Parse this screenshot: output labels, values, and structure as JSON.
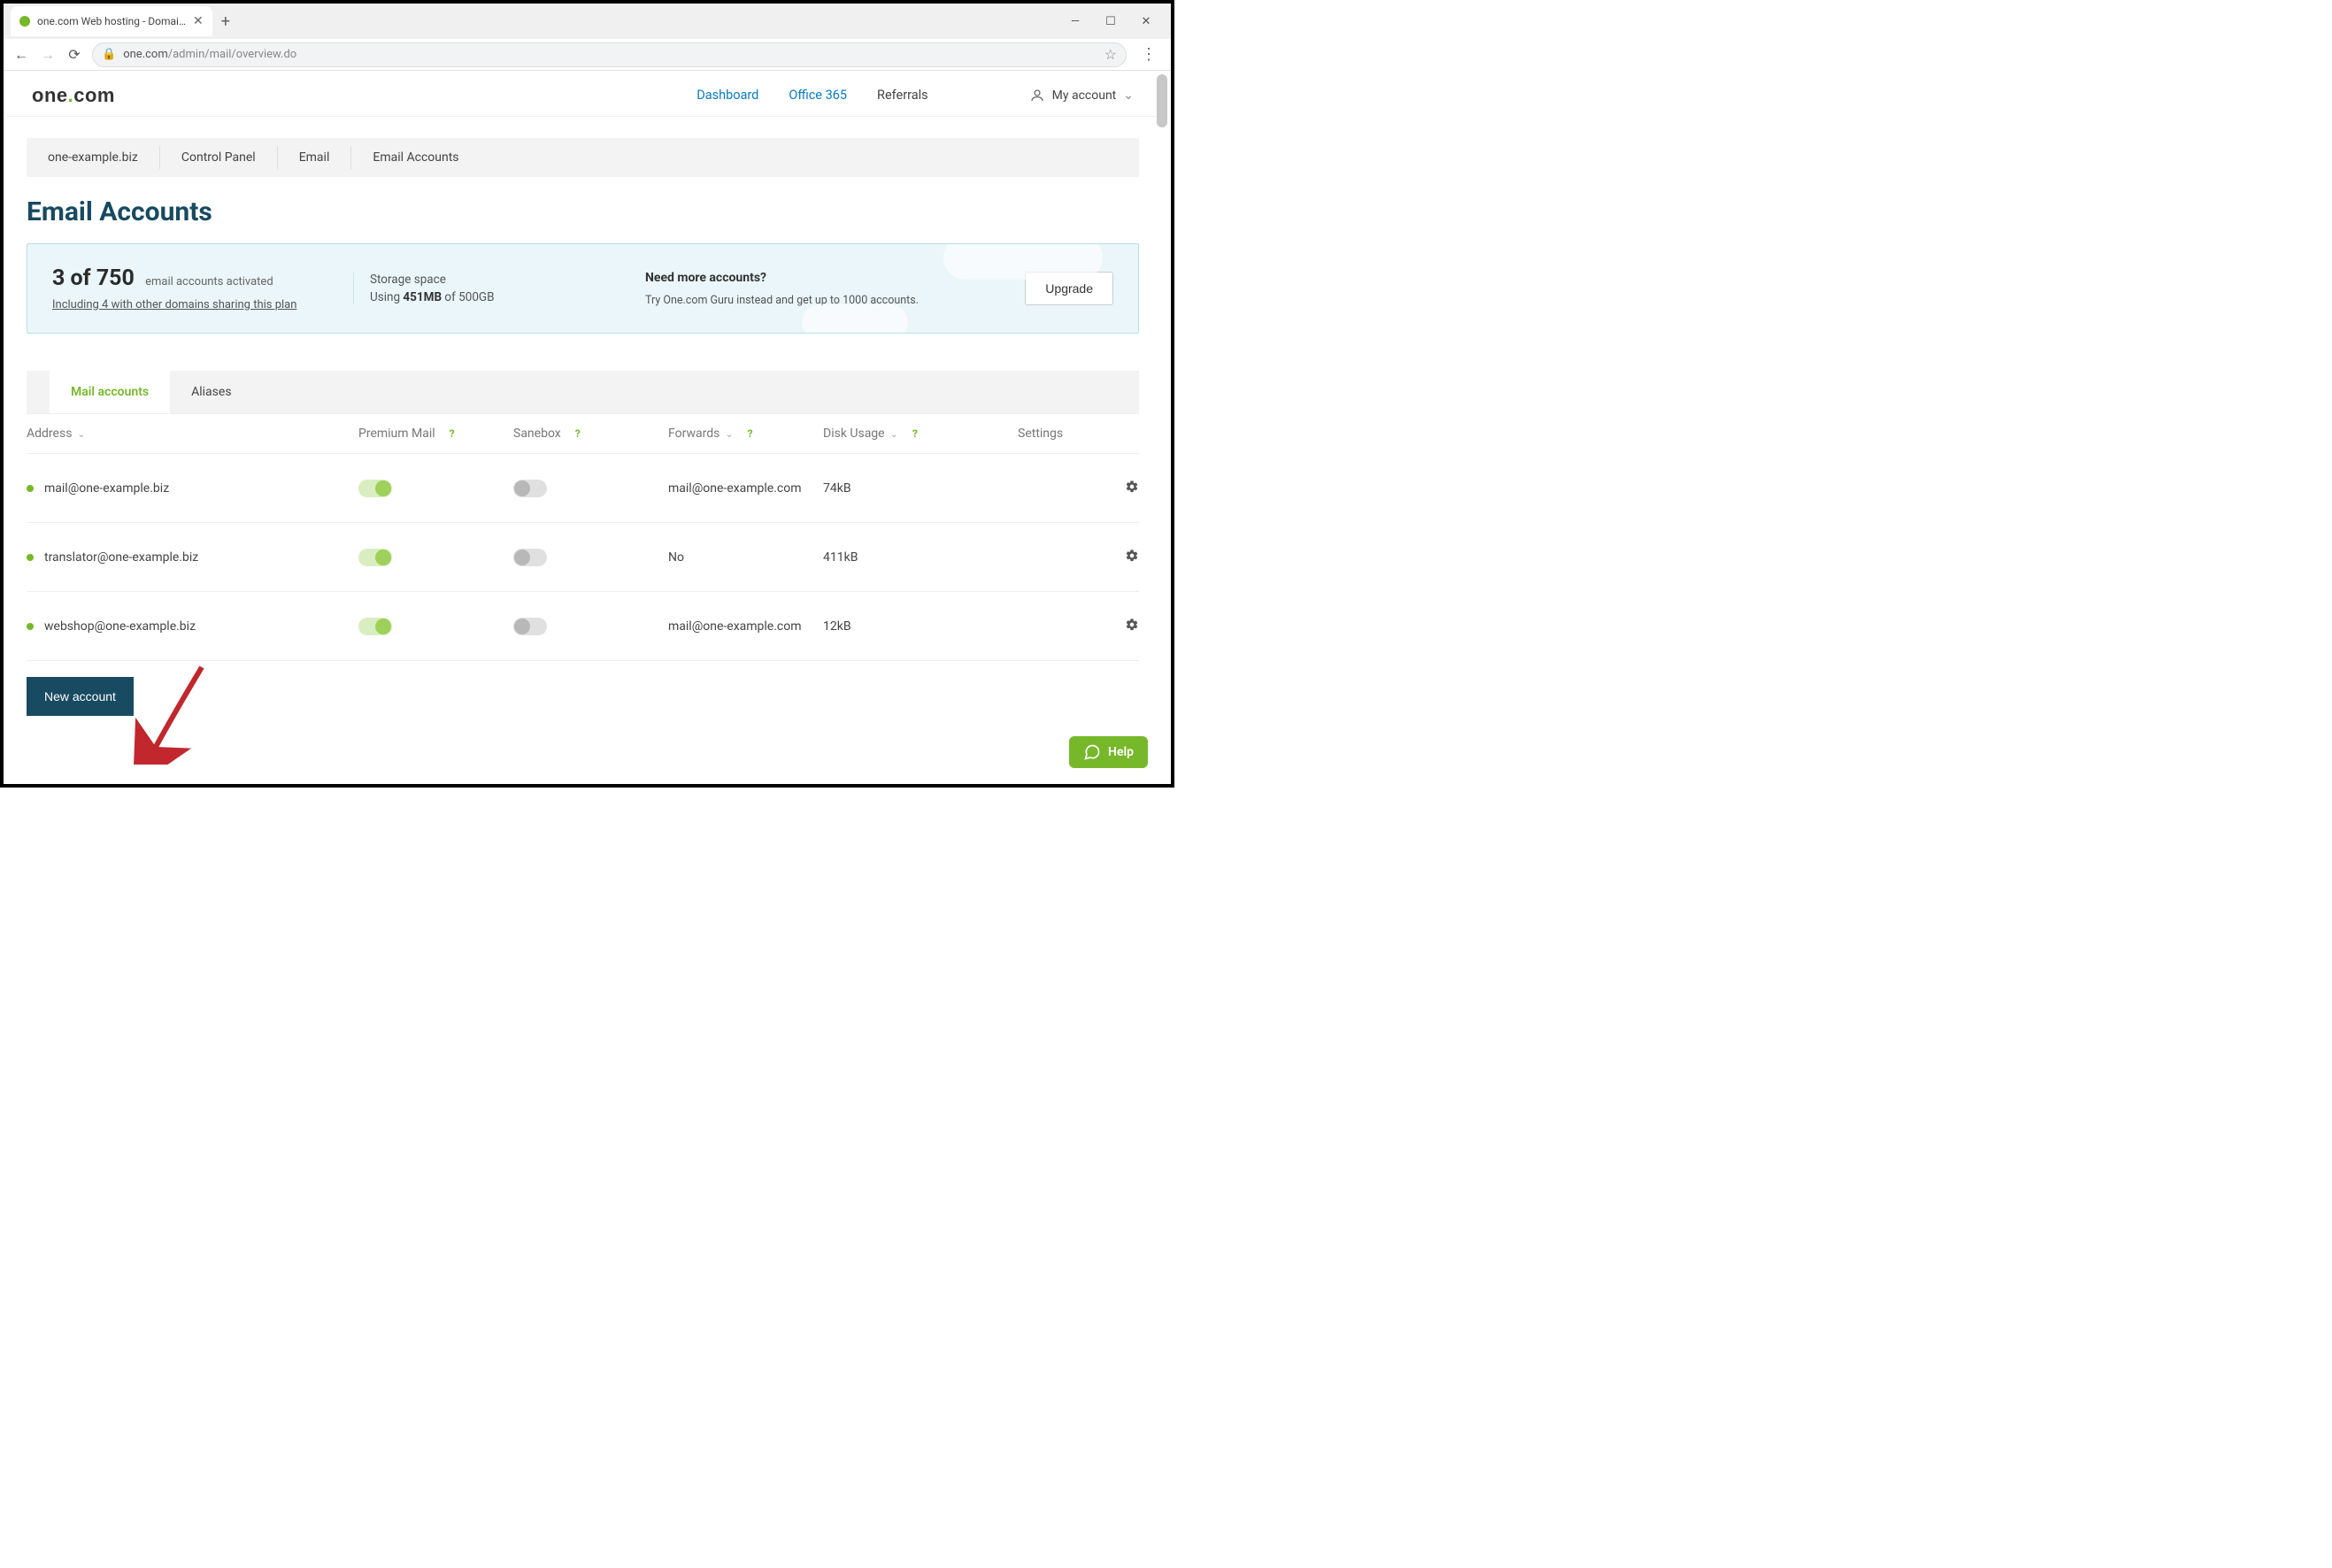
{
  "browser": {
    "tab_title": "one.com Web hosting  -  Domai…",
    "url_host": "one.com",
    "url_path": "/admin/mail/overview.do"
  },
  "nav": {
    "dashboard": "Dashboard",
    "office365": "Office 365",
    "referrals": "Referrals",
    "my_account": "My account"
  },
  "breadcrumb": {
    "domain": "one-example.biz",
    "cp": "Control Panel",
    "email": "Email",
    "accounts": "Email Accounts"
  },
  "title": "Email Accounts",
  "summary": {
    "activated_count": "3 of 750",
    "activated_label": "email accounts activated",
    "including_link": "Including 4 with other domains sharing this plan",
    "storage_label": "Storage space",
    "storage_using": "Using ",
    "storage_used": "451MB",
    "storage_of": " of 500GB",
    "need_title": "Need more accounts?",
    "need_sub": "Try One.com Guru instead and get up to 1000 accounts.",
    "upgrade": "Upgrade"
  },
  "tabs": {
    "mail_accounts": "Mail accounts",
    "aliases": "Aliases"
  },
  "columns": {
    "address": "Address",
    "premium": "Premium Mail",
    "sanebox": "Sanebox",
    "forwards": "Forwards",
    "disk": "Disk Usage",
    "settings": "Settings"
  },
  "rows": [
    {
      "address": "mail@one-example.biz",
      "premium": true,
      "sanebox": false,
      "forwards": "mail@one-example.com",
      "disk": "74kB"
    },
    {
      "address": "translator@one-example.biz",
      "premium": true,
      "sanebox": false,
      "forwards": "No",
      "disk": "411kB"
    },
    {
      "address": "webshop@one-example.biz",
      "premium": true,
      "sanebox": false,
      "forwards": "mail@one-example.com",
      "disk": "12kB"
    }
  ],
  "buttons": {
    "new_account": "New account",
    "help": "Help"
  },
  "colors": {
    "brand_green": "#76b82a",
    "brand_dark": "#184a61",
    "link_blue": "#0a7bbd"
  }
}
